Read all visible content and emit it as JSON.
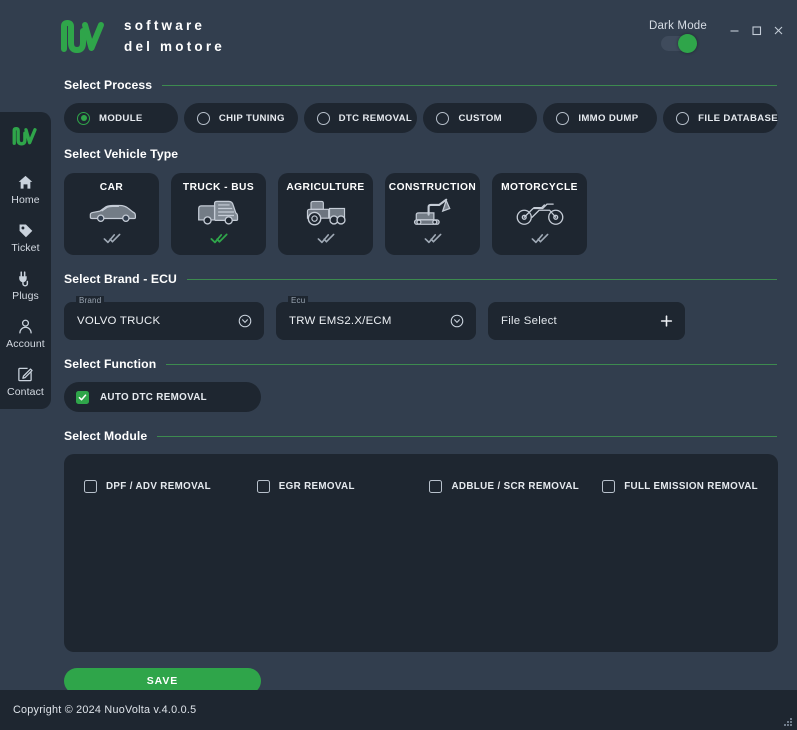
{
  "window": {
    "minimize_label": "–",
    "maximize_label": "☐",
    "close_label": "×"
  },
  "brand": {
    "name_line1": "software",
    "name_line2": "del motore",
    "logo_icon": "nuovolta-logo-icon",
    "accent_color": "#2fa54a"
  },
  "dark_mode": {
    "label": "Dark Mode",
    "enabled": true
  },
  "sidebar": {
    "logo_icon": "nuovolta-logo-icon",
    "items": [
      {
        "label": "Home",
        "icon": "home-icon"
      },
      {
        "label": "Ticket",
        "icon": "tag-icon"
      },
      {
        "label": "Plugs",
        "icon": "plug-icon"
      },
      {
        "label": "Account",
        "icon": "person-icon"
      },
      {
        "label": "Contact",
        "icon": "edit-square-icon"
      }
    ]
  },
  "process": {
    "title": "Select Process",
    "options": [
      {
        "label": "MODULE",
        "selected": true
      },
      {
        "label": "CHIP TUNING",
        "selected": false
      },
      {
        "label": "DTC REMOVAL",
        "selected": false
      },
      {
        "label": "CUSTOM",
        "selected": false
      },
      {
        "label": "IMMO DUMP",
        "selected": false
      },
      {
        "label": "FILE DATABASE",
        "selected": false
      }
    ]
  },
  "vehicle": {
    "title": "Select Vehicle Type",
    "options": [
      {
        "label": "CAR",
        "icon": "car-icon",
        "selected": false
      },
      {
        "label": "TRUCK - BUS",
        "icon": "truck-icon",
        "selected": true
      },
      {
        "label": "AGRICULTURE",
        "icon": "tractor-icon",
        "selected": false
      },
      {
        "label": "CONSTRUCTION",
        "icon": "excavator-icon",
        "selected": false
      },
      {
        "label": "MOTORCYCLE",
        "icon": "motorcycle-icon",
        "selected": false
      }
    ]
  },
  "brand_ecu": {
    "title": "Select Brand - ECU",
    "brand_field": {
      "label": "Brand",
      "value": "VOLVO TRUCK",
      "action_icon": "chevron-down-circle-icon"
    },
    "ecu_field": {
      "label": "Ecu",
      "value": "TRW EMS2.X/ECM",
      "action_icon": "chevron-down-circle-icon"
    },
    "file_select": {
      "value": "File Select",
      "action_icon": "plus-icon"
    }
  },
  "function": {
    "title": "Select Function",
    "options": [
      {
        "label": "AUTO DTC REMOVAL",
        "checked": true
      }
    ]
  },
  "module": {
    "title": "Select Module",
    "options": [
      {
        "label": "DPF / ADV REMOVAL",
        "checked": false
      },
      {
        "label": "EGR REMOVAL",
        "checked": false
      },
      {
        "label": "ADBLUE / SCR REMOVAL",
        "checked": false
      },
      {
        "label": "FULL EMISSION REMOVAL",
        "checked": false
      }
    ]
  },
  "actions": {
    "save_label": "SAVE"
  },
  "footer": {
    "copyright": "Copyright © 2024 NuoVolta v.4.0.0.5"
  }
}
